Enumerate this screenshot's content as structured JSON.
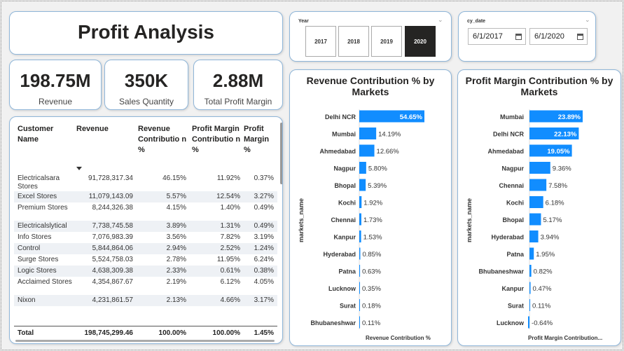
{
  "title": "Profit Analysis",
  "kpis": [
    {
      "value": "198.75M",
      "label": "Revenue"
    },
    {
      "value": "350K",
      "label": "Sales Quantity"
    },
    {
      "value": "2.88M",
      "label": "Total Profit Margin"
    }
  ],
  "table": {
    "headers": [
      "Customer Name",
      "Revenue",
      "Revenue Contributio n %",
      "Profit Margin Contributio n %",
      "Profit Margin %"
    ],
    "rows": [
      [
        "Electricalsara Stores",
        "91,728,317.34",
        "46.15%",
        "11.92%",
        "0.37%"
      ],
      [
        "Excel Stores",
        "11,079,143.09",
        "5.57%",
        "12.54%",
        "3.27%"
      ],
      [
        "Premium Stores",
        "8,244,326.38",
        "4.15%",
        "1.40%",
        "0.49%"
      ],
      [
        "Electricalslytical",
        "7,738,745.58",
        "3.89%",
        "1.31%",
        "0.49%"
      ],
      [
        "Info Stores",
        "7,076,983.39",
        "3.56%",
        "7.82%",
        "3.19%"
      ],
      [
        "Control",
        "5,844,864.06",
        "2.94%",
        "2.52%",
        "1.24%"
      ],
      [
        "Surge Stores",
        "5,524,758.03",
        "2.78%",
        "11.95%",
        "6.24%"
      ],
      [
        "Logic Stores",
        "4,638,309.38",
        "2.33%",
        "0.61%",
        "0.38%"
      ],
      [
        "Acclaimed Stores",
        "4,354,867.67",
        "2.19%",
        "6.12%",
        "4.05%"
      ],
      [
        "Nixon",
        "4,231,861.57",
        "2.13%",
        "4.66%",
        "3.17%"
      ]
    ],
    "total": {
      "label": "Total",
      "revenue": "198,745,299.46",
      "rev_contrib": "100.00%",
      "pm_contrib": "100.00%",
      "pm_pct": "1.45%"
    }
  },
  "year_slicer": {
    "label": "Year",
    "years": [
      "2017",
      "2018",
      "2019",
      "2020"
    ],
    "selected": "2020"
  },
  "date_slicer": {
    "label": "cy_date",
    "start": "6/1/2017",
    "end": "6/1/2020"
  },
  "colors": {
    "bar": "#118dff",
    "accent_border": "#8fb6d9",
    "selected": "#252423"
  },
  "chart_data": [
    {
      "type": "bar",
      "orientation": "horizontal",
      "title": "Revenue Contribution % by Markets",
      "xlabel": "Revenue Contribution %",
      "ylabel": "markets_name",
      "categories": [
        "Delhi NCR",
        "Mumbai",
        "Ahmedabad",
        "Nagpur",
        "Bhopal",
        "Kochi",
        "Chennai",
        "Kanpur",
        "Hyderabad",
        "Patna",
        "Lucknow",
        "Surat",
        "Bhubaneshwar"
      ],
      "values": [
        54.65,
        14.19,
        12.66,
        5.8,
        5.39,
        1.92,
        1.73,
        1.53,
        0.85,
        0.63,
        0.35,
        0.18,
        0.11
      ],
      "labels": [
        "54.65%",
        "14.19%",
        "12.66%",
        "5.80%",
        "5.39%",
        "1.92%",
        "1.73%",
        "1.53%",
        "0.85%",
        "0.63%",
        "0.35%",
        "0.18%",
        "0.11%"
      ],
      "grid": false
    },
    {
      "type": "bar",
      "orientation": "horizontal",
      "title": "Profit Margin Contribution % by Markets",
      "xlabel": "Profit Margin Contribution...",
      "ylabel": "markets_name",
      "categories": [
        "Mumbai",
        "Delhi NCR",
        "Ahmedabad",
        "Nagpur",
        "Chennai",
        "Kochi",
        "Bhopal",
        "Hyderabad",
        "Patna",
        "Bhubaneshwar",
        "Kanpur",
        "Surat",
        "Lucknow"
      ],
      "values": [
        23.89,
        22.13,
        19.05,
        9.36,
        7.58,
        6.18,
        5.17,
        3.94,
        1.95,
        0.82,
        0.47,
        0.11,
        -0.64
      ],
      "labels": [
        "23.89%",
        "22.13%",
        "19.05%",
        "9.36%",
        "7.58%",
        "6.18%",
        "5.17%",
        "3.94%",
        "1.95%",
        "0.82%",
        "0.47%",
        "0.11%",
        "-0.64%"
      ],
      "grid": false
    }
  ]
}
